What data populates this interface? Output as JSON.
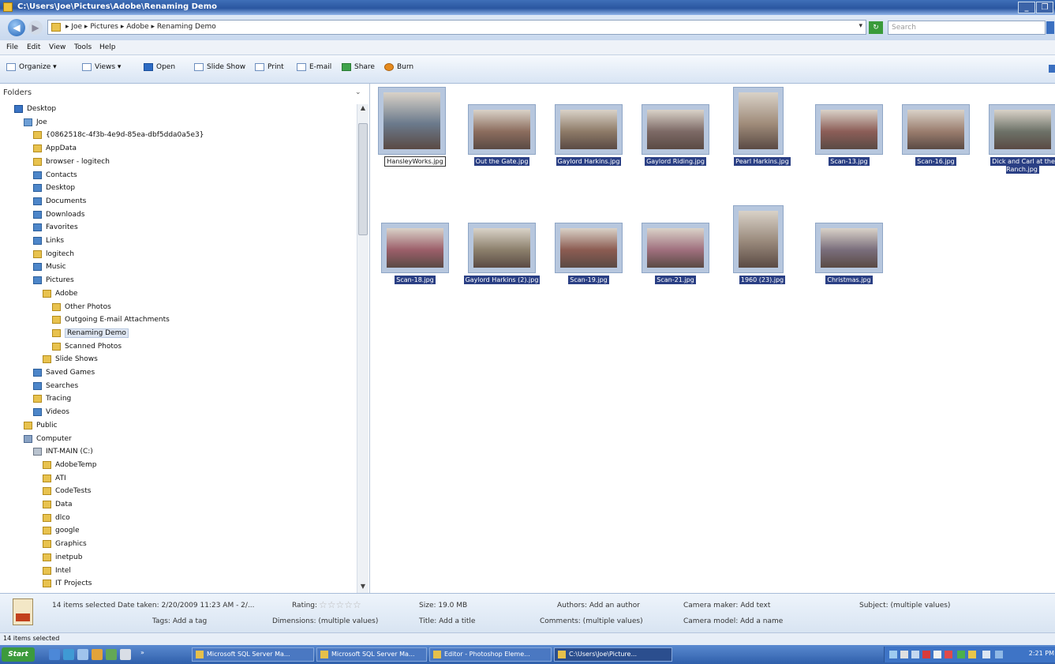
{
  "window": {
    "title": "C:\\Users\\Joe\\Pictures\\Adobe\\Renaming Demo",
    "controls": [
      "_",
      "❐"
    ]
  },
  "address": {
    "crumbs": "▸ Joe ▸ Pictures ▸ Adobe ▸ Renaming Demo",
    "search_placeholder": "Search"
  },
  "menu": [
    "File",
    "Edit",
    "View",
    "Tools",
    "Help"
  ],
  "toolbar": {
    "organize": "Organize ▾",
    "views": "Views ▾",
    "open": "Open",
    "slideshow": "Slide Show",
    "print": "Print",
    "email": "E-mail",
    "share": "Share",
    "burn": "Burn"
  },
  "folders": {
    "header": "Folders",
    "items": [
      {
        "label": "Desktop",
        "indent": 1,
        "icon": "desk"
      },
      {
        "label": "Joe",
        "indent": 2,
        "icon": "user"
      },
      {
        "label": "{0862518c-4f3b-4e9d-85ea-dbf5dda0a5e3}",
        "indent": 3,
        "icon": "folder"
      },
      {
        "label": "AppData",
        "indent": 3,
        "icon": "folder"
      },
      {
        "label": "browser - logitech",
        "indent": 3,
        "icon": "folder"
      },
      {
        "label": "Contacts",
        "indent": 3,
        "icon": "sys"
      },
      {
        "label": "Desktop",
        "indent": 3,
        "icon": "sys"
      },
      {
        "label": "Documents",
        "indent": 3,
        "icon": "sys"
      },
      {
        "label": "Downloads",
        "indent": 3,
        "icon": "sys"
      },
      {
        "label": "Favorites",
        "indent": 3,
        "icon": "sys"
      },
      {
        "label": "Links",
        "indent": 3,
        "icon": "sys"
      },
      {
        "label": "logitech",
        "indent": 3,
        "icon": "folder"
      },
      {
        "label": "Music",
        "indent": 3,
        "icon": "sys"
      },
      {
        "label": "Pictures",
        "indent": 3,
        "icon": "sys"
      },
      {
        "label": "Adobe",
        "indent": 4,
        "icon": "folder"
      },
      {
        "label": "Other Photos",
        "indent": 5,
        "icon": "folder"
      },
      {
        "label": "Outgoing E-mail Attachments",
        "indent": 5,
        "icon": "folder"
      },
      {
        "label": "Renaming Demo",
        "indent": 5,
        "icon": "folder",
        "selected": true
      },
      {
        "label": "Scanned Photos",
        "indent": 5,
        "icon": "folder"
      },
      {
        "label": "Slide Shows",
        "indent": 4,
        "icon": "folder"
      },
      {
        "label": "Saved Games",
        "indent": 3,
        "icon": "sys"
      },
      {
        "label": "Searches",
        "indent": 3,
        "icon": "sys"
      },
      {
        "label": "Tracing",
        "indent": 3,
        "icon": "folder"
      },
      {
        "label": "Videos",
        "indent": 3,
        "icon": "sys"
      },
      {
        "label": "Public",
        "indent": 2,
        "icon": "folder"
      },
      {
        "label": "Computer",
        "indent": 2,
        "icon": "comp"
      },
      {
        "label": "INT-MAIN (C:)",
        "indent": 3,
        "icon": "drive"
      },
      {
        "label": "AdobeTemp",
        "indent": 4,
        "icon": "folder"
      },
      {
        "label": "ATI",
        "indent": 4,
        "icon": "folder"
      },
      {
        "label": "CodeTests",
        "indent": 4,
        "icon": "folder"
      },
      {
        "label": "Data",
        "indent": 4,
        "icon": "folder"
      },
      {
        "label": "dlco",
        "indent": 4,
        "icon": "folder"
      },
      {
        "label": "google",
        "indent": 4,
        "icon": "folder"
      },
      {
        "label": "Graphics",
        "indent": 4,
        "icon": "folder"
      },
      {
        "label": "inetpub",
        "indent": 4,
        "icon": "folder"
      },
      {
        "label": "Intel",
        "indent": 4,
        "icon": "folder"
      },
      {
        "label": "IT Projects",
        "indent": 4,
        "icon": "folder"
      }
    ]
  },
  "files": [
    {
      "name": "HansleyWorks.jpg",
      "focus": true,
      "portrait": true,
      "tone": "#6b7a8c"
    },
    {
      "name": "Out the Gate.jpg",
      "tone": "#8c6d5e"
    },
    {
      "name": "Gaylord Harkins.jpg",
      "tone": "#8e7b68"
    },
    {
      "name": "Gaylord Riding.jpg",
      "tone": "#7d6a66"
    },
    {
      "name": "Pearl Harkins.jpg",
      "portrait": true,
      "tone": "#a08c7a"
    },
    {
      "name": "Scan-13.jpg",
      "tone": "#8c5e58"
    },
    {
      "name": "Scan-16.jpg",
      "tone": "#9a7d6e"
    },
    {
      "name": "Dick and Carl at the Ranch.jpg",
      "tone": "#6d7268"
    },
    {
      "name": "Scan-18.jpg",
      "tone": "#9c5f6a"
    },
    {
      "name": "Gaylord Harkins (2).jpg",
      "tone": "#8c806c"
    },
    {
      "name": "Scan-19.jpg",
      "tone": "#8c5c52"
    },
    {
      "name": "Scan-21.jpg",
      "tone": "#a0707e"
    },
    {
      "name": "1960 (23).jpg",
      "portrait": true,
      "tone": "#98887a"
    },
    {
      "name": "Christmas.jpg",
      "tone": "#7a6e7c"
    }
  ],
  "details": {
    "summary": "14 items selected  Date taken: 2/20/2009 11:23 AM - 2/...",
    "tags": "Tags: Add a tag",
    "rating": "Rating:",
    "stars": "☆☆☆☆☆",
    "dimensions": "Dimensions: (multiple values)",
    "size": "Size: 19.0 MB",
    "title": "Title: Add a title",
    "authors": "Authors: Add an author",
    "comments": "Comments: (multiple values)",
    "camera_maker": "Camera maker: Add text",
    "camera_model": "Camera model: Add a name",
    "subject": "Subject: (multiple values)"
  },
  "status": "14 items selected",
  "taskbar": {
    "start": "Start",
    "tasks": [
      {
        "label": "Microsoft SQL Server Ma..."
      },
      {
        "label": "Microsoft SQL Server Ma..."
      },
      {
        "label": "Editor - Photoshop Eleme..."
      },
      {
        "label": "C:\\Users\\Joe\\Picture...",
        "active": true
      }
    ],
    "clock": "2:21 PM"
  },
  "colors": {
    "selection": "#2a3f84",
    "titlebar": "#2a56a0",
    "taskbar": "#2f5fab"
  }
}
